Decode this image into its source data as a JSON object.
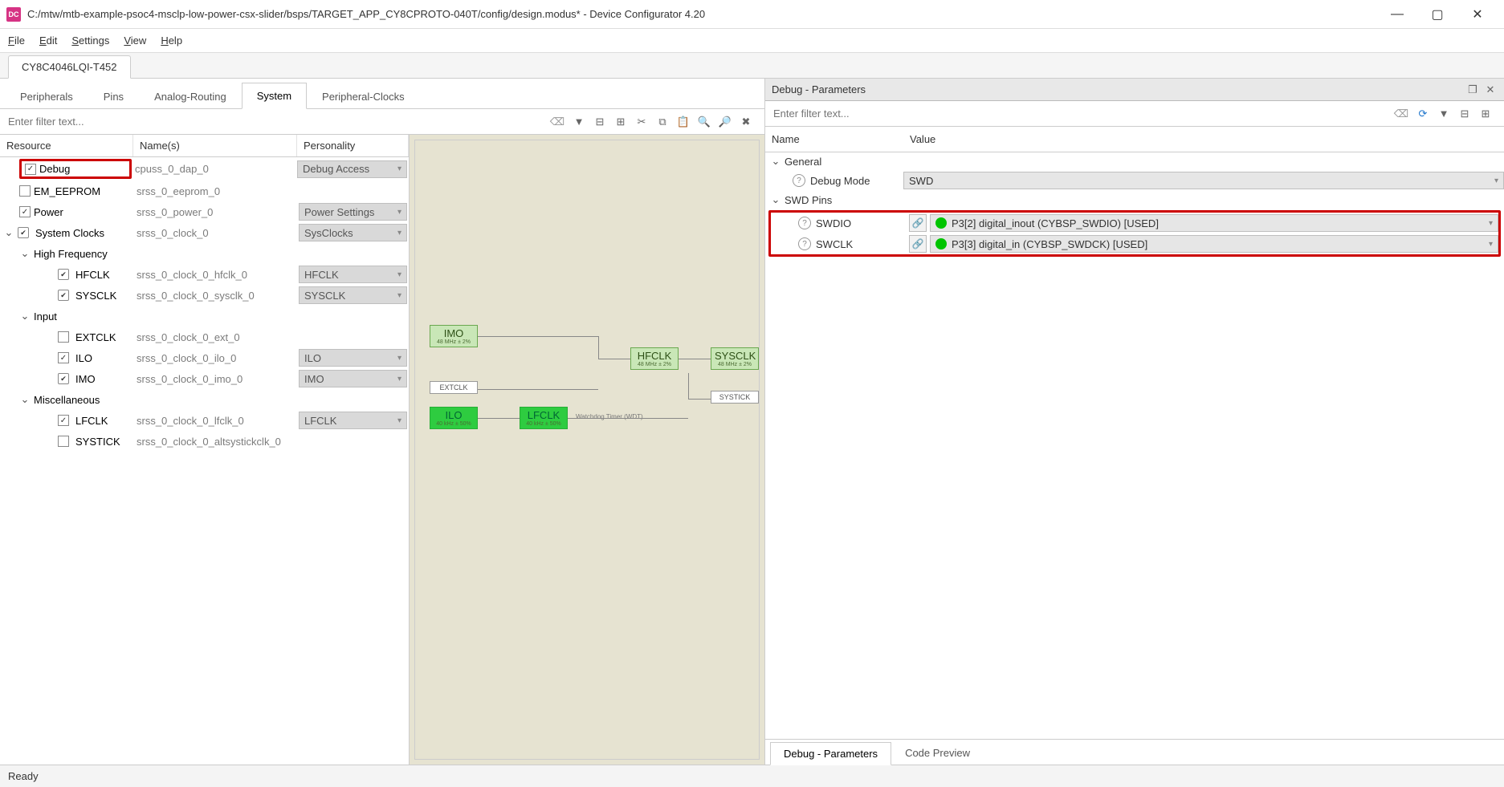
{
  "window": {
    "title": "C:/mtw/mtb-example-psoc4-msclp-low-power-csx-slider/bsps/TARGET_APP_CY8CPROTO-040T/config/design.modus* - Device Configurator 4.20"
  },
  "menus": {
    "file": "File",
    "edit": "Edit",
    "settings": "Settings",
    "view": "View",
    "help": "Help"
  },
  "device_tab": "CY8C4046LQI-T452",
  "sub_tabs": {
    "peripherals": "Peripherals",
    "pins": "Pins",
    "analog": "Analog-Routing",
    "system": "System",
    "pclocks": "Peripheral-Clocks"
  },
  "filter_placeholder": "Enter filter text...",
  "tree_headers": {
    "resource": "Resource",
    "names": "Name(s)",
    "personality": "Personality"
  },
  "tree": {
    "debug": {
      "label": "Debug",
      "name": "cpuss_0_dap_0",
      "personality": "Debug Access"
    },
    "eeprom": {
      "label": "EM_EEPROM",
      "name": "srss_0_eeprom_0",
      "personality": ""
    },
    "power": {
      "label": "Power",
      "name": "srss_0_power_0",
      "personality": "Power Settings"
    },
    "sysclk": {
      "label": "System Clocks",
      "name": "srss_0_clock_0",
      "personality": "SysClocks"
    },
    "hf_group": "High Frequency",
    "hfclk": {
      "label": "HFCLK",
      "name": "srss_0_clock_0_hfclk_0",
      "personality": "HFCLK"
    },
    "syscl": {
      "label": "SYSCLK",
      "name": "srss_0_clock_0_sysclk_0",
      "personality": "SYSCLK"
    },
    "in_group": "Input",
    "extclk": {
      "label": "EXTCLK",
      "name": "srss_0_clock_0_ext_0",
      "personality": ""
    },
    "ilo": {
      "label": "ILO",
      "name": "srss_0_clock_0_ilo_0",
      "personality": "ILO"
    },
    "imo": {
      "label": "IMO",
      "name": "srss_0_clock_0_imo_0",
      "personality": "IMO"
    },
    "misc_group": "Miscellaneous",
    "lfclk": {
      "label": "LFCLK",
      "name": "srss_0_clock_0_lfclk_0",
      "personality": "LFCLK"
    },
    "systick": {
      "label": "SYSTICK",
      "name": "srss_0_clock_0_altsystickclk_0",
      "personality": ""
    }
  },
  "diagram": {
    "imo": "IMO",
    "imo_sub": "48 MHz ± 2%",
    "extclk": "EXTCLK",
    "ilo": "ILO",
    "ilo_sub": "40 kHz ± 50%",
    "lfclk": "LFCLK",
    "lfclk_sub": "40 kHz ± 50%",
    "wdt": "Watchdog Timer (WDT)",
    "hfclk": "HFCLK",
    "hfclk_sub": "48 MHz ± 2%",
    "sysclk": "SYSCLK",
    "sysclk_sub": "48 MHz ± 2%",
    "systick": "SYSTICK"
  },
  "right": {
    "panel_title": "Debug - Parameters",
    "filter_placeholder": "Enter filter text...",
    "hdr_name": "Name",
    "hdr_value": "Value",
    "general": "General",
    "debug_mode_label": "Debug Mode",
    "debug_mode_value": "SWD",
    "swd_pins": "SWD Pins",
    "swdio_label": "SWDIO",
    "swdio_value": "P3[2] digital_inout (CYBSP_SWDIO) [USED]",
    "swclk_label": "SWCLK",
    "swclk_value": "P3[3] digital_in (CYBSP_SWDCK) [USED]"
  },
  "bottom_tabs": {
    "params": "Debug - Parameters",
    "preview": "Code Preview"
  },
  "status": "Ready"
}
